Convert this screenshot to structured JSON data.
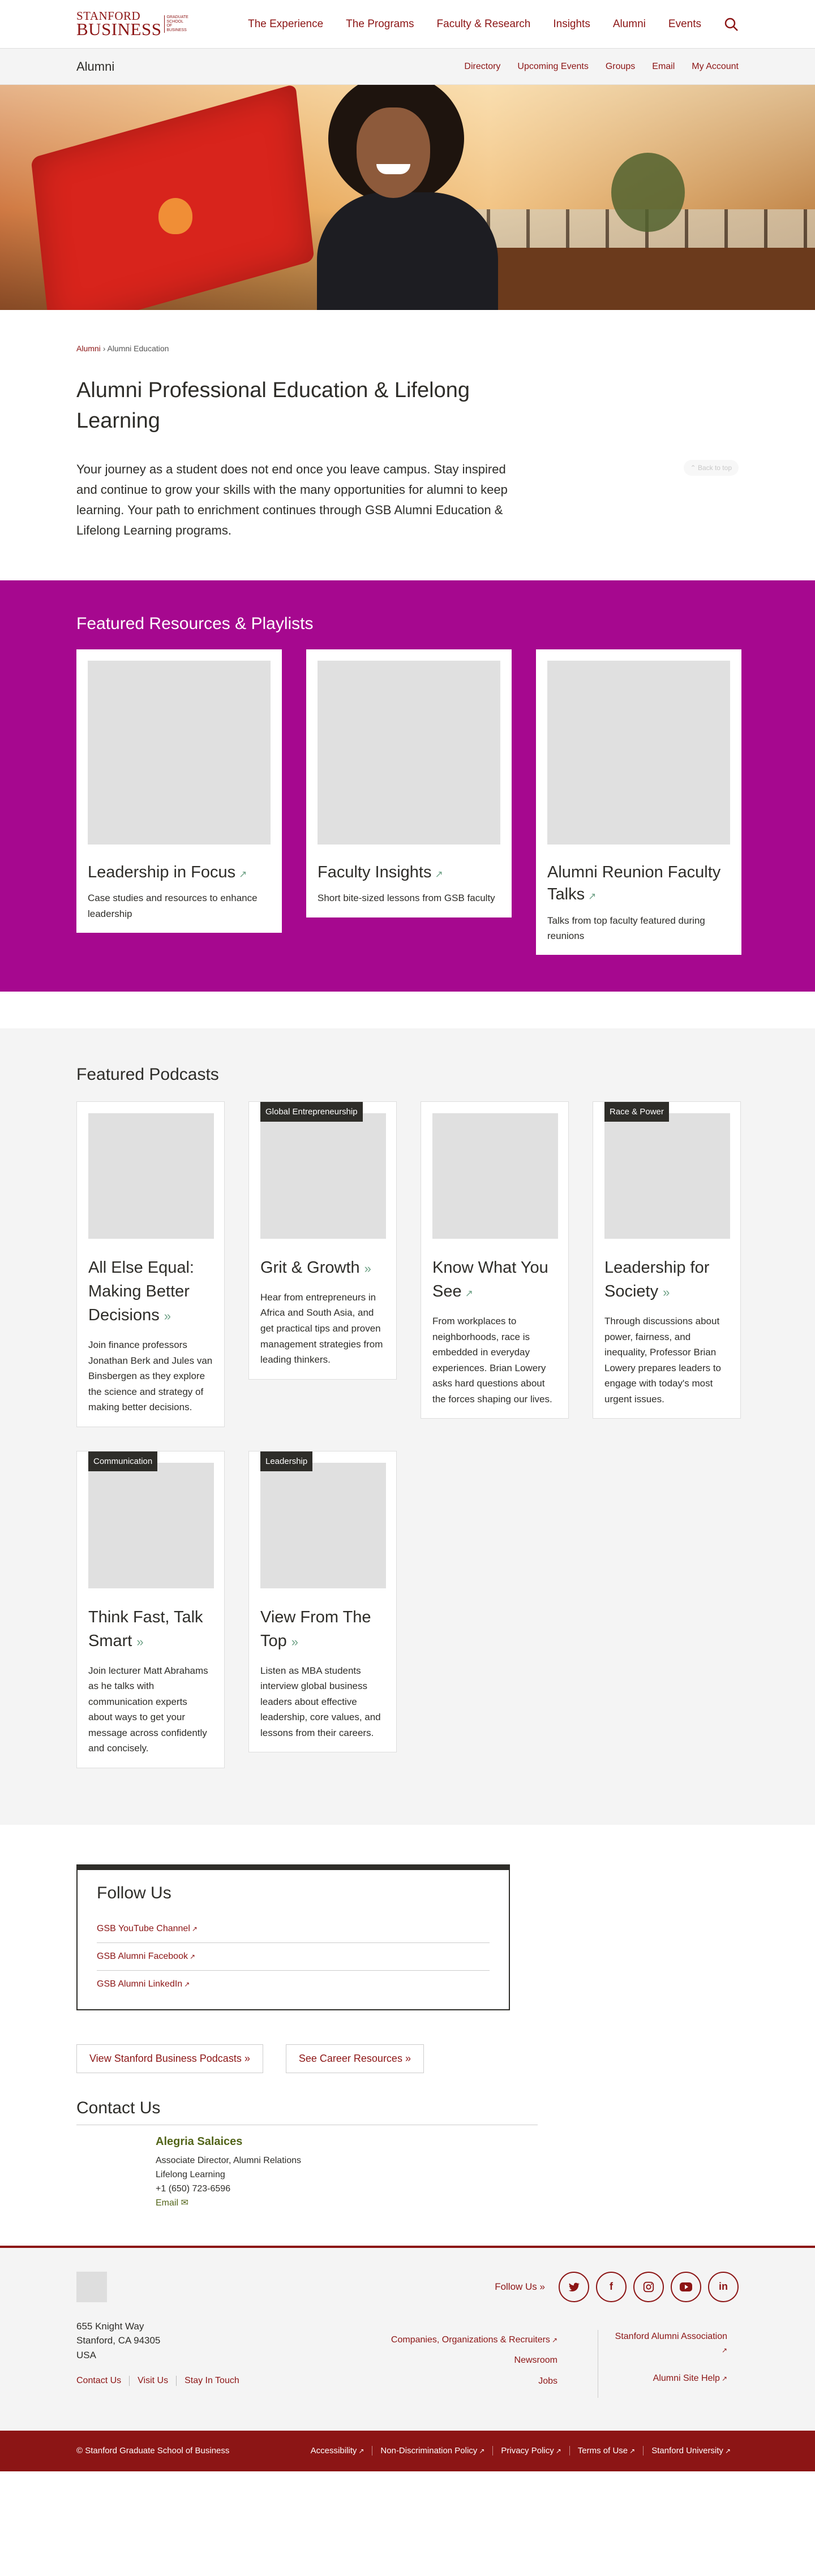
{
  "header": {
    "logo_line1": "STANFORD",
    "logo_line2": "BUSINESS",
    "logo_sub": "GRADUATE SCHOOL OF BUSINESS",
    "nav": [
      "The Experience",
      "The Programs",
      "Faculty & Research",
      "Insights",
      "Alumni",
      "Events"
    ]
  },
  "subheader": {
    "title": "Alumni",
    "nav": [
      "Directory",
      "Upcoming Events",
      "Groups",
      "Email",
      "My Account"
    ]
  },
  "breadcrumb": {
    "root": "Alumni",
    "separator": "›",
    "current": "Alumni Education"
  },
  "intro": {
    "title": "Alumni Professional Education & Lifelong Learning",
    "text": "Your journey as a student does not end once you leave campus. Stay inspired and continue to grow your skills with the many opportunities for alumni to keep learning. Your path to enrichment continues through GSB Alumni Education & Lifelong Learning programs.",
    "back_to_top": "⌃ Back to top"
  },
  "featured_resources": {
    "heading": "Featured Resources & Playlists",
    "cards": [
      {
        "title": "Leadership in Focus",
        "desc": "Case studies and resources to enhance leadership"
      },
      {
        "title": "Faculty Insights",
        "desc": "Short bite-sized lessons from GSB faculty"
      },
      {
        "title": "Alumni Reunion Faculty Talks",
        "desc": "Talks from top faculty featured during reunions"
      }
    ]
  },
  "podcasts": {
    "heading": "Featured Podcasts",
    "cards": [
      {
        "tag": "",
        "title": "All Else Equal: Making Better Decisions",
        "desc": "Join finance professors Jonathan Berk and Jules van Binsbergen as they explore the science and strategy of making better decisions."
      },
      {
        "tag": "Global Entrepreneurship",
        "title": "Grit & Growth",
        "desc": "Hear from entrepreneurs in Africa and South Asia, and get practical tips and proven management strategies from leading thinkers."
      },
      {
        "tag": "",
        "title": "Know What You See",
        "desc": "From workplaces to neighborhoods, race is embedded in everyday experiences. Brian Lowery asks hard questions about the forces shaping our lives."
      },
      {
        "tag": "Race & Power",
        "title": "Leadership for Society",
        "desc": "Through discussions about power, fairness, and inequality, Professor Brian Lowery prepares leaders to engage with today's most urgent issues."
      },
      {
        "tag": "Communication",
        "title": "Think Fast, Talk Smart",
        "desc": "Join lecturer Matt Abrahams as he talks with communication experts about ways to get your message across confidently and concisely."
      },
      {
        "tag": "Leadership",
        "title": "View From The Top",
        "desc": "Listen as MBA students interview global business leaders about effective leadership, core values, and lessons from their careers."
      }
    ]
  },
  "follow_us": {
    "heading": "Follow Us",
    "links": [
      "GSB YouTube Channel",
      "GSB Alumni Facebook",
      "GSB Alumni LinkedIn"
    ]
  },
  "ctas": [
    "View Stanford Business Podcasts",
    "See Career Resources"
  ],
  "contact": {
    "heading": "Contact Us",
    "name": "Alegria Salaices",
    "role": "Associate Director, Alumni Relations",
    "dept": "Lifelong Learning",
    "phone": "+1 (650) 723-6596",
    "email_label": "Email"
  },
  "footer": {
    "address": [
      "655 Knight Way",
      "Stanford, CA 94305",
      "USA"
    ],
    "links": [
      "Contact Us",
      "Visit Us",
      "Stay In Touch"
    ],
    "follow_label": "Follow Us",
    "social": [
      "twitter-icon",
      "facebook-icon",
      "instagram-icon",
      "youtube-icon",
      "linkedin-icon"
    ],
    "col1": [
      "Companies, Organizations & Recruiters",
      "Newsroom",
      "Jobs"
    ],
    "col2": [
      "Stanford Alumni Association",
      "Alumni Site Help"
    ]
  },
  "bottom_bar": {
    "copyright": "© Stanford Graduate School of Business",
    "links": [
      "Accessibility",
      "Non-Discrimination Policy",
      "Privacy Policy",
      "Terms of Use",
      "Stanford University"
    ]
  },
  "colors": {
    "brand": "#8c1515",
    "featured_bg": "#a6088f",
    "accent_green": "#6fa287"
  }
}
